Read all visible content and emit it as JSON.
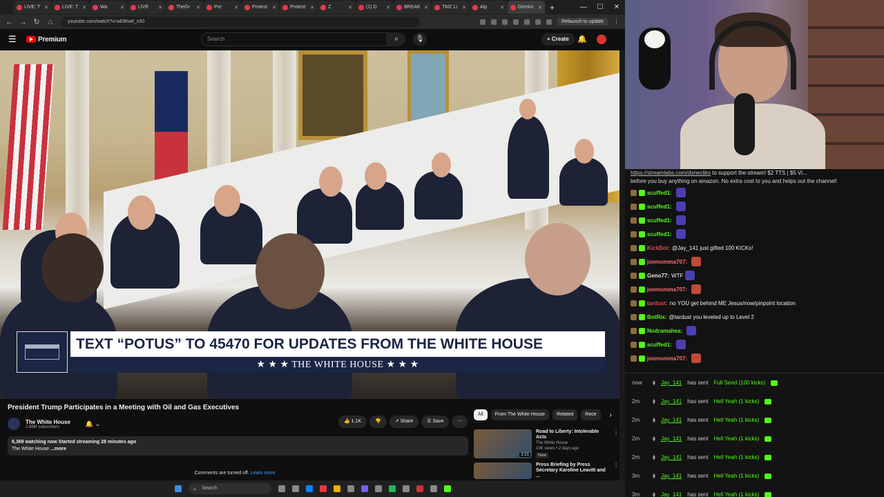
{
  "browser": {
    "tabs": [
      {
        "label": "LIVE: T"
      },
      {
        "label": "LIVE: T"
      },
      {
        "label": "Wa"
      },
      {
        "label": "LIVE"
      },
      {
        "label": "TheGr"
      },
      {
        "label": "Pre"
      },
      {
        "label": "Protest"
      },
      {
        "label": "Protest"
      },
      {
        "label": "Z"
      },
      {
        "label": "(1) D"
      },
      {
        "label": "BREAK"
      },
      {
        "label": "TMZ Li"
      },
      {
        "label": "Alp"
      },
      {
        "label": "Gemini"
      }
    ],
    "new_tab": "+",
    "url": "youtube.com/watch?v=aEBIw8_x30",
    "relaunch": "Relaunch to update",
    "controls": {
      "minimize": "—",
      "maximize": "☐",
      "close": "✕"
    }
  },
  "youtube": {
    "brand": "Premium",
    "search_placeholder": "Search",
    "create_label": "+ Create",
    "video": {
      "banner_text": "TEXT “POTUS” TO 45470 FOR UPDATES FROM THE WHITE HOUSE",
      "banner_sub": "★ ★ ★   THE WHITE HOUSE   ★ ★ ★"
    },
    "title": "President Trump Participates in a Meeting with Oil and Gas Executives",
    "channel": {
      "name": "The White House",
      "subs": "2.88M subscribers"
    },
    "actions": {
      "likes": "👍 1.1K",
      "dislike": "👎",
      "share": "↗ Share",
      "save": "☰ Save",
      "more": "⋯"
    },
    "description": {
      "line1": "6,369 watching now  Started streaming 28 minutes ago",
      "line2": "The White House",
      "more": "...more"
    },
    "comments": {
      "off": "Comments are turned off.",
      "learn": "Learn more"
    },
    "chips": [
      "All",
      "From The White House",
      "Related",
      "Rece"
    ],
    "recommendations": [
      {
        "title": "Road to Liberty: Intolerable Acts",
        "channel": "The White House",
        "meta": "10K views • 2 days ago",
        "badge": "New",
        "duration": "2:21"
      },
      {
        "title": "Press Briefing by Press Secretary Karoline Leavitt and ...",
        "channel": "The White House",
        "meta": "",
        "badge": "",
        "duration": ""
      }
    ]
  },
  "taskbar": {
    "search": "Search"
  },
  "chat": {
    "top_link": "https://streamlabs.com/donecliks",
    "top_line1_rest": " to support the stream! $2 TTS | $5 Vi...",
    "top_line2": "before you buy anything on amazon. No extra cost to you and helps out the channel!",
    "messages": [
      {
        "user": "scuffed1:",
        "color": "green",
        "text": ""
      },
      {
        "user": "scuffed1:",
        "color": "green",
        "text": ""
      },
      {
        "user": "scuffed1:",
        "color": "green",
        "text": ""
      },
      {
        "user": "scuffed1:",
        "color": "green",
        "text": ""
      },
      {
        "user": "KickBot:",
        "color": "red",
        "text": "@Jay_141 just gifted 100 KICKs!"
      },
      {
        "user": "joemomma707:",
        "color": "pink",
        "text": ""
      },
      {
        "user": "Geno77:",
        "color": "white",
        "text": "WTF"
      },
      {
        "user": "joemomma707:",
        "color": "pink",
        "text": ""
      },
      {
        "user": "tardust:",
        "color": "red",
        "text": "no YOU get behind ME Jesus/now/pinpoint location"
      },
      {
        "user": "BotRix:",
        "color": "green",
        "text": "@tardust you leveled up to Level 2"
      },
      {
        "user": "Nodramahea:",
        "color": "green",
        "text": ""
      },
      {
        "user": "scuffed1:",
        "color": "green",
        "text": ""
      },
      {
        "user": "joemomma707:",
        "color": "pink",
        "text": ""
      }
    ]
  },
  "alerts": [
    {
      "time": "now",
      "user": "Jay_141",
      "mid": "has sent",
      "what": "Full Send (100 kicks)"
    },
    {
      "time": "2m",
      "user": "Jay_141",
      "mid": "has sent",
      "what": "Hell Yeah (1 kicks)"
    },
    {
      "time": "2m",
      "user": "Jay_141",
      "mid": "has sent",
      "what": "Hell Yeah (1 kicks)"
    },
    {
      "time": "2m",
      "user": "Jay_141",
      "mid": "has sent",
      "what": "Hell Yeah (1 kicks)"
    },
    {
      "time": "2m",
      "user": "Jay_141",
      "mid": "has sent",
      "what": "Hell Yeah (1 kicks)"
    },
    {
      "time": "3m",
      "user": "Jay_141",
      "mid": "has sent",
      "what": "Hell Yeah (1 kicks)"
    },
    {
      "time": "3m",
      "user": "Jay_141",
      "mid": "has sent",
      "what": "Hell Yeah (1 kicks)"
    }
  ],
  "colors": {
    "kick_green": "#53fc18",
    "yt_red": "#ff0000",
    "wh_navy": "#1b2544"
  }
}
